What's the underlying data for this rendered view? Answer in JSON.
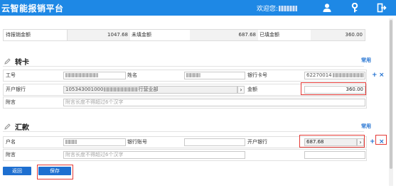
{
  "header": {
    "app_title": "云智能报销平台",
    "welcome": "欢迎您:"
  },
  "summary": {
    "pending_label": "待报销金额",
    "pending_value": "1047.68",
    "unfilled_label": "未填金额",
    "unfilled_value": "687.68",
    "filled_label": "已填金额",
    "filled_value": "360.00"
  },
  "transfer": {
    "title": "转卡",
    "common": "常用",
    "emp_no_label": "工号",
    "name_label": "姓名",
    "card_no_label": "银行卡号",
    "card_no_value": "62270014",
    "bank_label": "开户银行",
    "bank_value": "105343001000",
    "bank_suffix": "行营业部",
    "amount_label": "金额",
    "amount_value": "360.00",
    "remark_label": "附言",
    "remark_placeholder": "附言长度不得超过6个汉字",
    "add": "+",
    "remove": "×"
  },
  "remit": {
    "title": "汇款",
    "common": "常用",
    "account_name_label": "户名",
    "bank_account_label": "银行账号",
    "bank_label": "开户银行",
    "amount_value": "687.68",
    "remark_label": "附言",
    "remark_placeholder": "附言长度不得超过6个汉字",
    "add": "+",
    "remove": "×"
  },
  "buttons": {
    "back": "返回",
    "save": "保存"
  },
  "colors": {
    "header_bg": "#1e88e5",
    "accent": "#1e6fd0",
    "highlight": "#e53935"
  },
  "icons": [
    "user-icon",
    "key-icon",
    "logout-icon",
    "pencil-icon",
    "chevron-right-icon"
  ]
}
